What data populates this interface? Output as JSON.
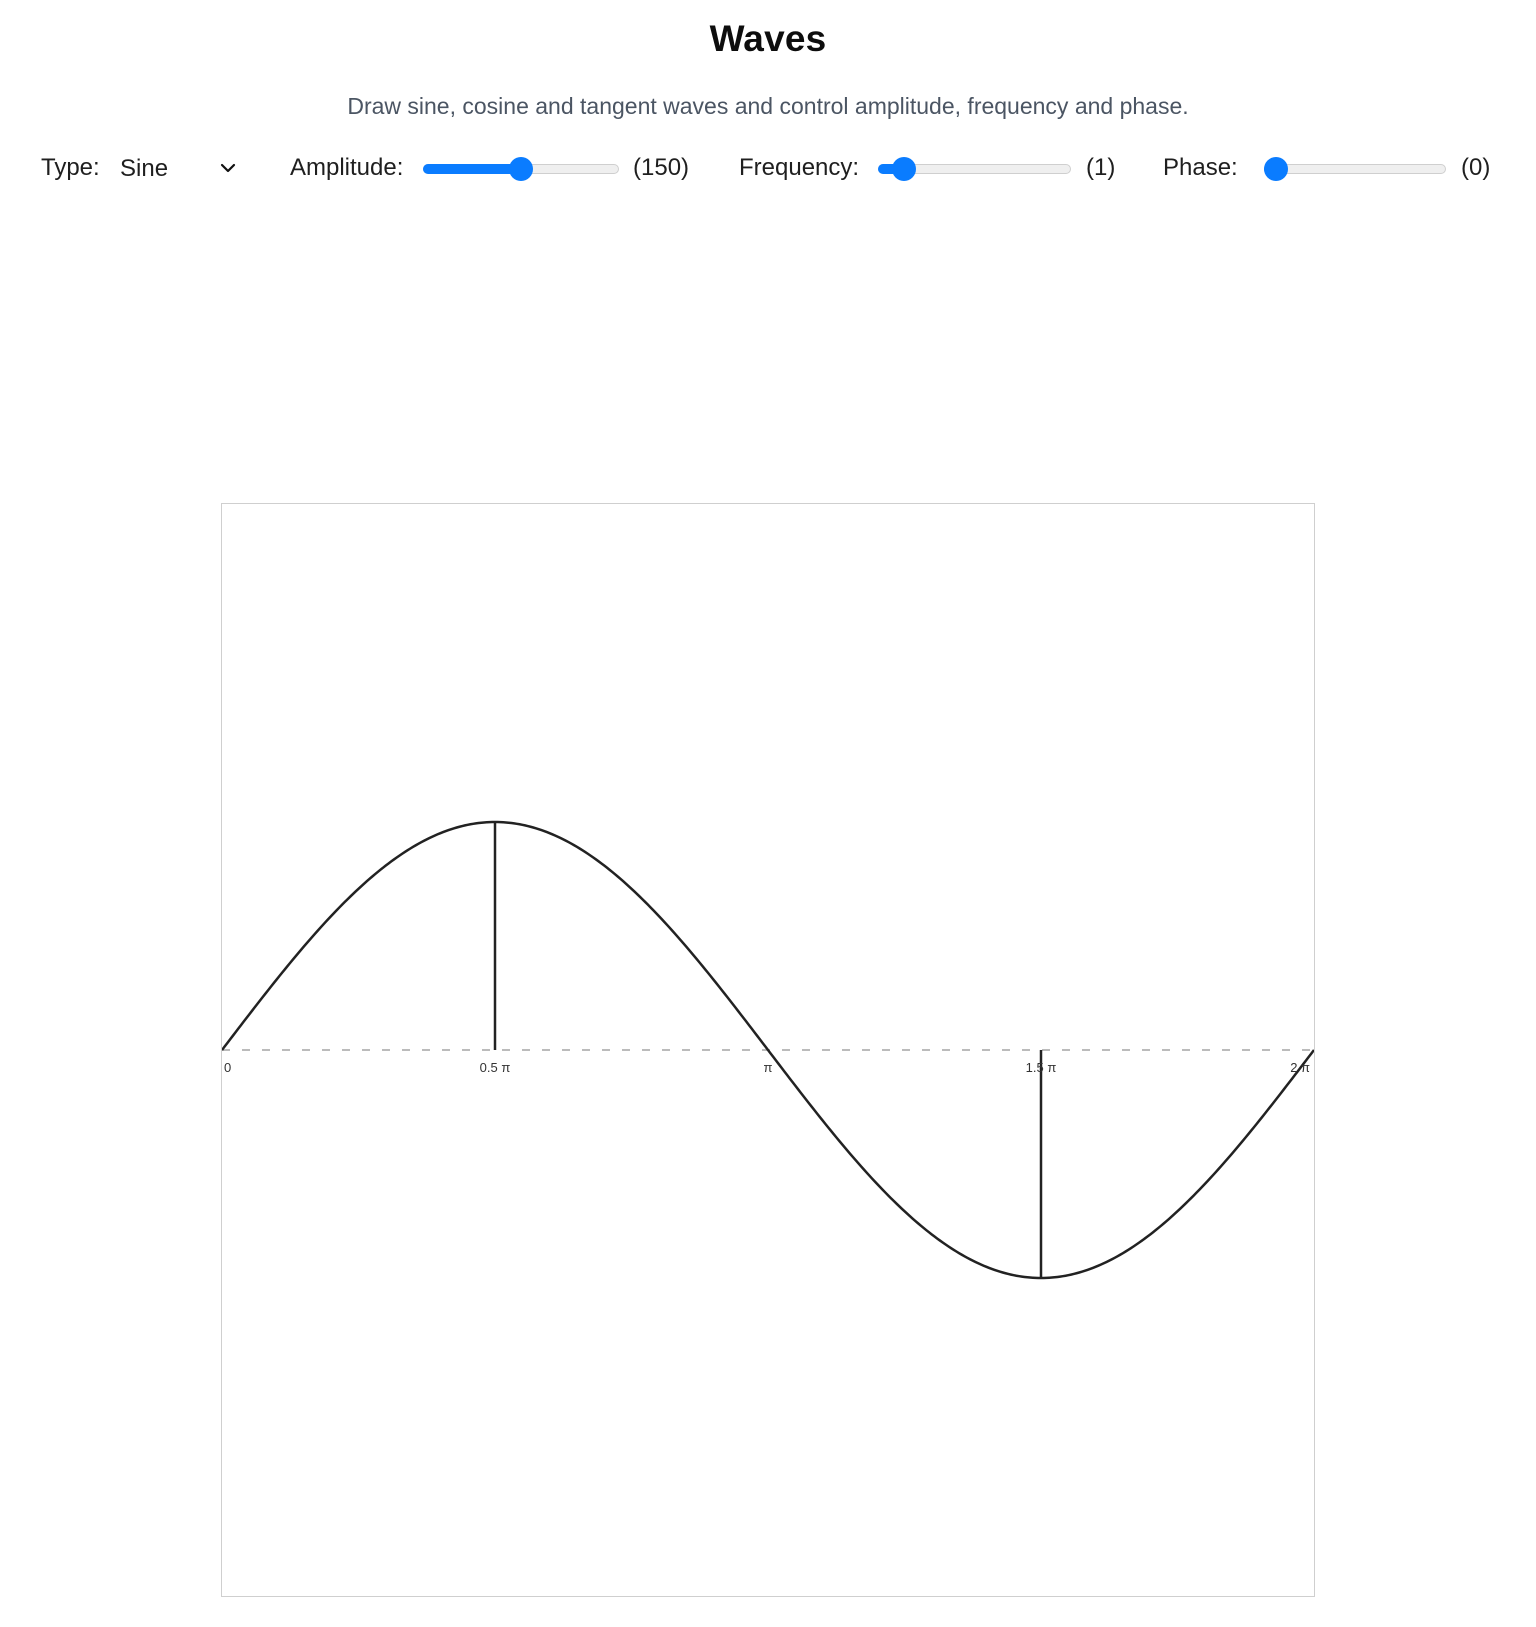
{
  "header": {
    "title": "Waves",
    "subtitle": "Draw sine, cosine and tangent waves and control amplitude, frequency and phase."
  },
  "controls": {
    "type": {
      "label": "Type:",
      "selected": "Sine"
    },
    "amplitude": {
      "label": "Amplitude:",
      "value_text": "(150)",
      "value": 150,
      "fill_fraction": 0.5
    },
    "frequency": {
      "label": "Frequency:",
      "value_text": "(1)",
      "value": 1,
      "fill_fraction": 0.08
    },
    "phase": {
      "label": "Phase:",
      "value_text": "(0)",
      "value": 0,
      "fill_fraction": 0.0
    }
  },
  "colors": {
    "accent": "#0a7cff",
    "curve": "#222222",
    "axis": "#bbbbbb"
  },
  "chart_data": {
    "type": "line",
    "function": "sine",
    "amplitude": 150,
    "frequency": 1,
    "phase": 0,
    "x_range": [
      0,
      6.283185307
    ],
    "y_range": [
      -1.5,
      1.5
    ],
    "x_ticks": [
      "0",
      "0.5 π",
      "π",
      "1.5 π",
      "2 π"
    ],
    "x_tick_values": [
      0,
      1.5707963,
      3.1415927,
      4.712389,
      6.2831853
    ],
    "markers": [
      {
        "x": 1.5707963,
        "y": 1
      },
      {
        "x": 4.712389,
        "y": -1
      }
    ],
    "axis_style": "dashed"
  }
}
